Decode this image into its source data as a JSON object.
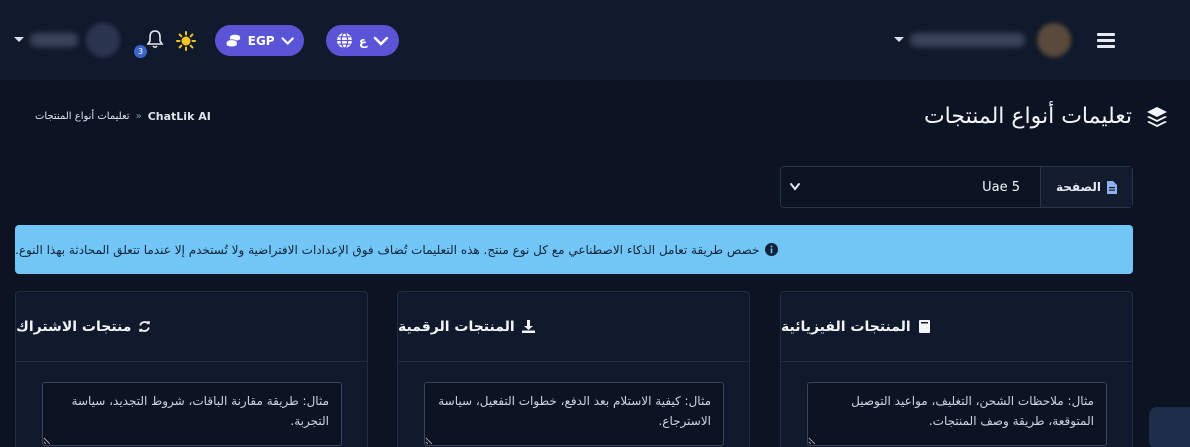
{
  "topbar": {
    "notification_count": "3",
    "currency_label": "EGP",
    "language_label": "ع"
  },
  "page": {
    "title": "تعليمات أنواع المنتجات"
  },
  "breadcrumb": {
    "home": "ChatLik AI",
    "separator": "»",
    "current": "تعليمات أنواع المنتجات"
  },
  "page_select": {
    "label": "الصفحة",
    "selected": "Uae 5"
  },
  "info_alert": {
    "text": "خصص طريقة تعامل الذكاء الاصطناعي مع كل نوع منتج. هذه التعليمات تُضاف فوق الإعدادات الافتراضية ولا تُستخدم إلا عندما تتعلق المحادثة بهذا النوع."
  },
  "cards": [
    {
      "title": "المنتجات الفيزيائية",
      "placeholder": "مثال: ملاحظات الشحن، التغليف، مواعيد التوصيل المتوقعة، طريقة وصف المنتجات."
    },
    {
      "title": "المنتجات الرقمية",
      "placeholder": "مثال: كيفية الاستلام بعد الدفع، خطوات التفعيل، سياسة الاسترجاع."
    },
    {
      "title": "منتجات الاشتراك",
      "placeholder": "مثال: طريقة مقارنة الباقات، شروط التجديد، سياسة التجربة."
    }
  ],
  "colors": {
    "background": "#0c1322",
    "topbar": "#111a2c",
    "accent": "#5a55d6",
    "alert": "#72c6f5"
  }
}
